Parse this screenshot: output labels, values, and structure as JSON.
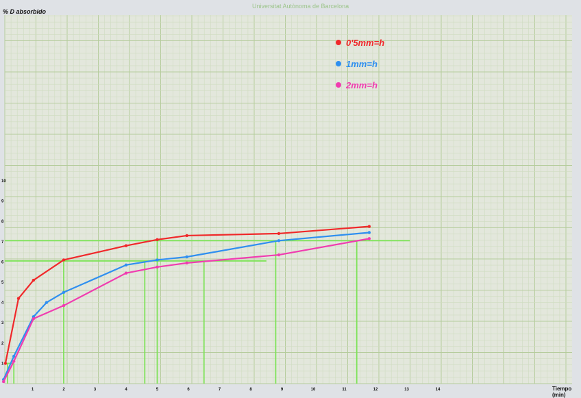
{
  "header": {
    "text": "Universitat Autònoma de Barcelona"
  },
  "chart_data": {
    "type": "line",
    "title": "",
    "xlabel": "Tiempo (min)",
    "ylabel": "% D absorbido",
    "xlim": [
      0,
      18
    ],
    "ylim": [
      0,
      18
    ],
    "x_ticks": [
      "1",
      "2",
      "3",
      "4",
      "5",
      "6",
      "7",
      "8",
      "9",
      "10",
      "11",
      "12",
      "13",
      "14"
    ],
    "y_ticks": [
      "1",
      "2",
      "3",
      "4",
      "5",
      "6",
      "7",
      "8",
      "9",
      "10"
    ],
    "grid": true,
    "legend_position": "top-right",
    "series": [
      {
        "name": "0'5mm=h",
        "color": "#f0282a",
        "x": [
          0.13,
          0.55,
          1.03,
          2,
          4,
          5,
          5.95,
          8.9,
          11.8
        ],
        "y": [
          1,
          4.2,
          5.1,
          6.1,
          6.8,
          7.1,
          7.3,
          7.4,
          7.75
        ]
      },
      {
        "name": "1mm=h",
        "color": "#2f8ff0",
        "x": [
          0.07,
          0.4,
          1.03,
          1.45,
          2,
          4,
          5,
          5.95,
          8.9,
          11.8
        ],
        "y": [
          0.2,
          1.35,
          3.3,
          4,
          4.5,
          5.85,
          6.1,
          6.25,
          7.05,
          7.45
        ]
      },
      {
        "name": "2mm=h",
        "color": "#f03cb0",
        "x": [
          0.07,
          0.4,
          1.03,
          2,
          4,
          5,
          5.95,
          8.9,
          11.8
        ],
        "y": [
          0.1,
          1.1,
          3.2,
          3.85,
          5.45,
          5.75,
          5.95,
          6.35,
          7.15
        ]
      }
    ],
    "reference_lines": {
      "horizontal": [
        {
          "y": 7.05,
          "x_end": 13.1
        },
        {
          "y": 6.05,
          "x_end": 8.5
        },
        {
          "y": 1,
          "x_end": 0.4
        }
      ],
      "vertical": [
        {
          "x": 2,
          "y_end": 6.05
        },
        {
          "x": 4.6,
          "y_end": 6.05
        },
        {
          "x": 5,
          "y_end": 7.05
        },
        {
          "x": 6.5,
          "y_end": 6.05
        },
        {
          "x": 8.8,
          "y_end": 7.05
        },
        {
          "x": 11.4,
          "y_end": 7.05
        },
        {
          "x": 0.2,
          "y_end": 1
        },
        {
          "x": 0.4,
          "y_end": 1
        }
      ]
    },
    "colors": {
      "guide": "#7fe35a",
      "grid_minor": "#cfdcc0",
      "grid_major": "#b5cc9c",
      "paper": "#e3e7dc"
    }
  }
}
